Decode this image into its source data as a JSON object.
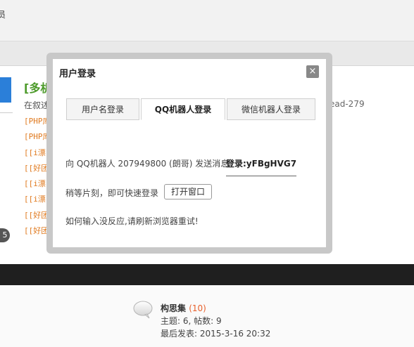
{
  "background": {
    "top_text": "员",
    "post": {
      "title": "[多机器",
      "description": "在叙述",
      "description_right": "ead-279",
      "list_items": [
        "[PHP库]",
        "[PHP库]",
        "[[i漂白",
        "[[好团队",
        "[[i漂白",
        "[[i漂白",
        "[[好团队",
        "[[好团队"
      ]
    },
    "page_number": "5",
    "forum": {
      "name": "构思集",
      "count": "(10)",
      "stats": "主题: 6, 帖数: 9",
      "last_post": "最后发表: 2015-3-16 20:32"
    }
  },
  "modal": {
    "title": "用户登录",
    "close_icon": "close-icon",
    "close_label": "×",
    "tabs": [
      {
        "label": "用户名登录",
        "active": false
      },
      {
        "label": "QQ机器人登录",
        "active": true
      },
      {
        "label": "微信机器人登录",
        "active": false
      }
    ],
    "instruction": "向 QQ机器人 207949800 (朗哥) 发送消息",
    "login_code": "登录:yFBgHVG7",
    "wait_text": "稍等片刻，即可快速登录",
    "open_window_button": "打开窗口",
    "hint": "如何输入没反应,请刷新浏览器重试!"
  },
  "colors": {
    "accent_blue": "#2b7fd9",
    "title_green": "#4c9a2a",
    "list_orange": "#e07a1f",
    "count_orange": "#e8602c",
    "dark_bar": "#1f1f1f"
  }
}
